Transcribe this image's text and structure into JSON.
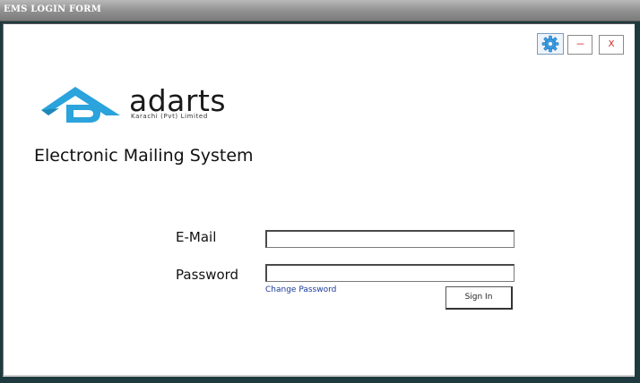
{
  "window": {
    "title": "EMS LOGIN FORM"
  },
  "controls": {
    "settings_icon": "gear-icon",
    "minimize_label": "---",
    "close_label": "X"
  },
  "logo": {
    "word": "adarts",
    "subtitle": "Karachi (Pvt) Limited",
    "color": "#2ba3dc"
  },
  "app": {
    "title": "Electronic Mailing System"
  },
  "form": {
    "email_label": "E-Mail",
    "email_value": "",
    "password_label": "Password",
    "password_value": "",
    "change_password_link": "Change Password",
    "sign_in_label": "Sign In"
  },
  "colors": {
    "link": "#1a3a9a",
    "control_text": "#d02020"
  }
}
